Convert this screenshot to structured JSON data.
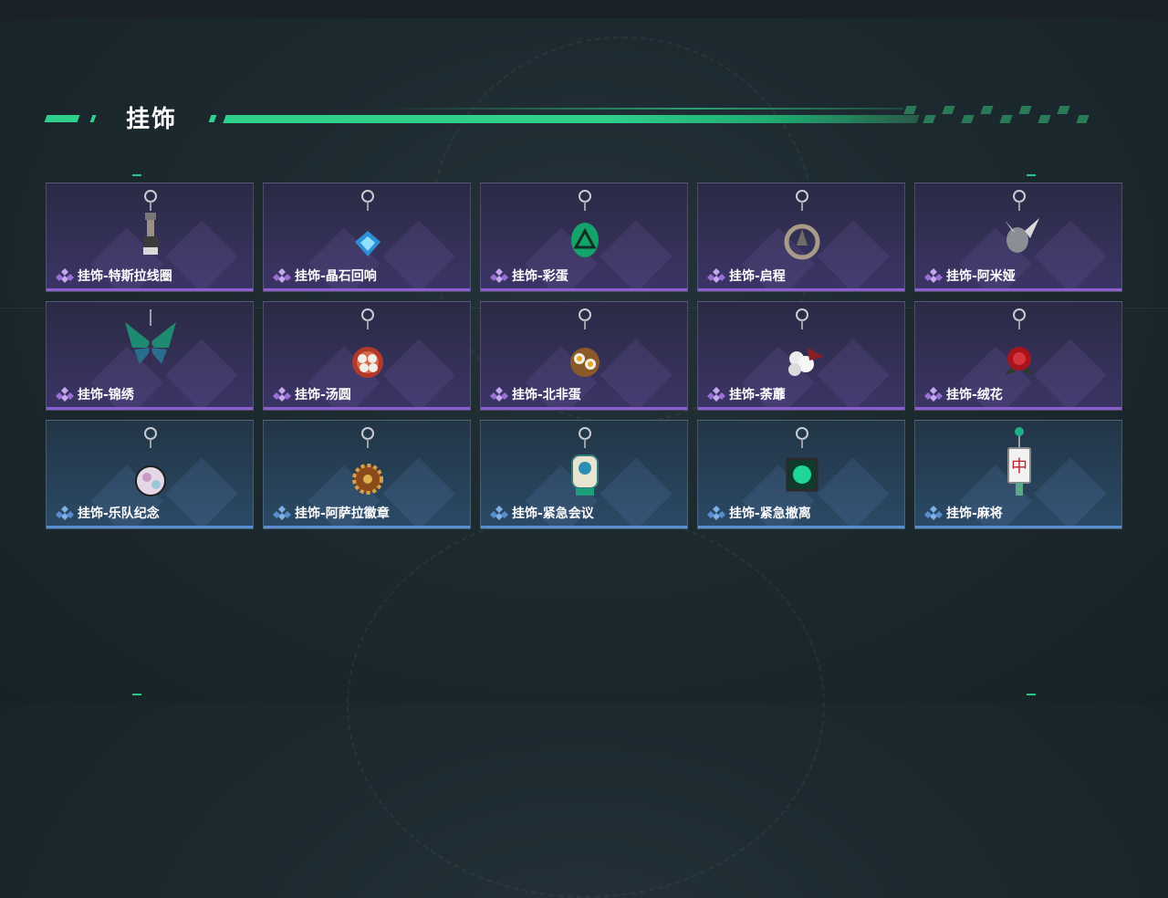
{
  "section": {
    "title": "挂饰"
  },
  "colors": {
    "accent": "#2fd08c",
    "rare_purple": "#8b5fd0",
    "uncommon_blue": "#5b8ed0"
  },
  "items": [
    {
      "label": "挂饰-特斯拉线圈",
      "rarity": "purple",
      "icon": "tesla-coil-charm-icon"
    },
    {
      "label": "挂饰-晶石回响",
      "rarity": "purple",
      "icon": "crystal-charm-icon"
    },
    {
      "label": "挂饰-彩蛋",
      "rarity": "purple",
      "icon": "green-egg-charm-icon"
    },
    {
      "label": "挂饰-启程",
      "rarity": "purple",
      "icon": "compass-ring-charm-icon"
    },
    {
      "label": "挂饰-阿米娅",
      "rarity": "purple",
      "icon": "bunny-charm-icon"
    },
    {
      "label": "挂饰-锦绣",
      "rarity": "purple",
      "icon": "butterfly-charm-icon"
    },
    {
      "label": "挂饰-汤圆",
      "rarity": "purple",
      "icon": "dumpling-bowl-charm-icon"
    },
    {
      "label": "挂饰-北非蛋",
      "rarity": "purple",
      "icon": "shakshuka-charm-icon"
    },
    {
      "label": "挂饰-荼蘼",
      "rarity": "purple",
      "icon": "white-flower-charm-icon"
    },
    {
      "label": "挂饰-绒花",
      "rarity": "purple",
      "icon": "red-rose-charm-icon"
    },
    {
      "label": "挂饰-乐队纪念",
      "rarity": "blue",
      "icon": "band-badge-charm-icon"
    },
    {
      "label": "挂饰-阿萨拉徽章",
      "rarity": "blue",
      "icon": "golden-sun-badge-charm-icon"
    },
    {
      "label": "挂饰-紧急会议",
      "rarity": "blue",
      "icon": "meeting-figure-charm-icon"
    },
    {
      "label": "挂饰-紧急撤离",
      "rarity": "blue",
      "icon": "green-exit-charm-icon"
    },
    {
      "label": "挂饰-麻将",
      "rarity": "blue",
      "icon": "mahjong-tile-charm-icon"
    }
  ]
}
